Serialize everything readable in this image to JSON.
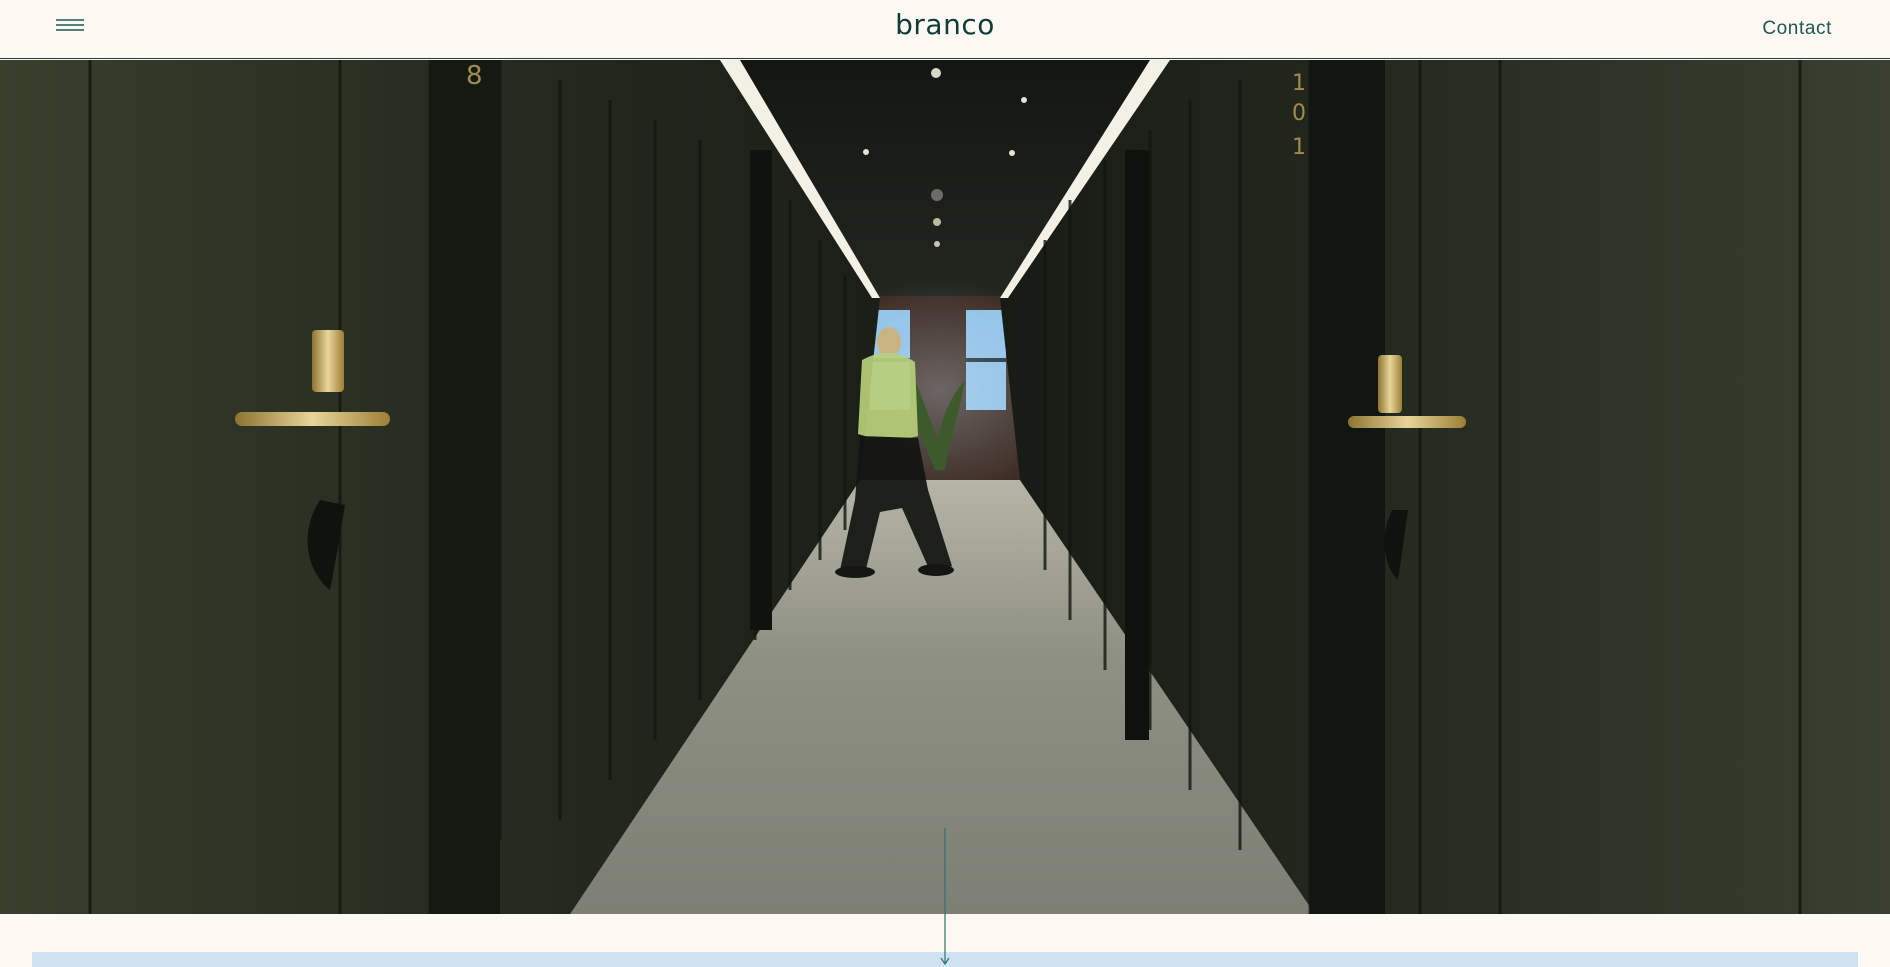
{
  "header": {
    "logo_text": "branco",
    "contact_label": "Contact",
    "menu_icon": "hamburger-menu-icon"
  },
  "hero": {
    "image_description_icon": "hotel-corridor-photo"
  },
  "colors": {
    "background": "#fdf9f2",
    "brand": "#0f3b3a",
    "link": "#1f5755",
    "strip": "#cfe2ef"
  }
}
